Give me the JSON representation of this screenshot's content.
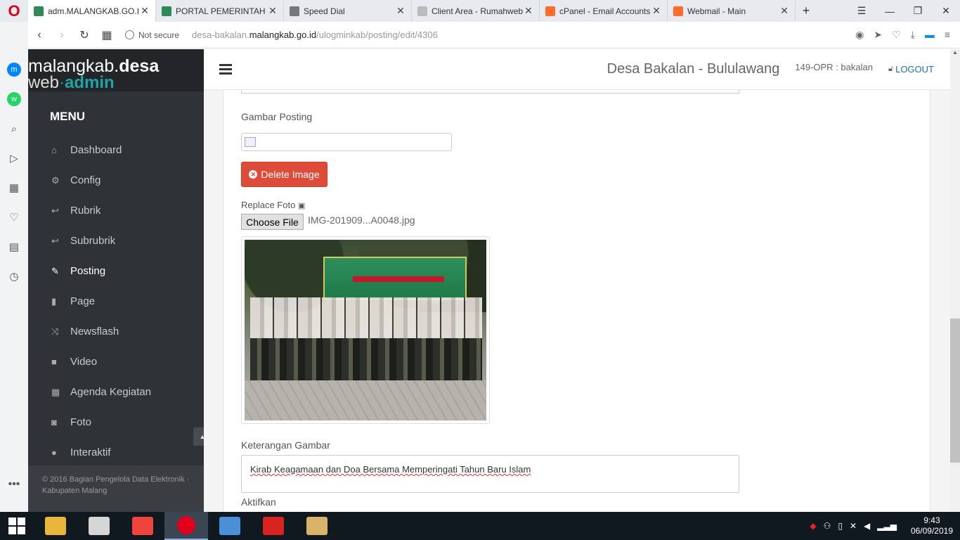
{
  "browser": {
    "tabs": [
      {
        "title": "adm.MALANGKAB.GO.ID",
        "active": true
      },
      {
        "title": "PORTAL PEMERINTAH K",
        "active": false
      },
      {
        "title": "Speed Dial",
        "active": false
      },
      {
        "title": "Client Area - Rumahweb",
        "active": false
      },
      {
        "title": "cPanel - Email Accounts",
        "active": false
      },
      {
        "title": "Webmail - Main",
        "active": false
      }
    ],
    "security_label": "Not secure",
    "url_prefix": "desa-bakalan.",
    "url_host": "malangkab.go.id",
    "url_path": "/ulogminkab/posting/edit/4306"
  },
  "brand": {
    "line1_plain": "malangkab.",
    "line1_bold": "desa",
    "line2_plain": "web",
    "line2_dot": "·",
    "line2_bold": "admin"
  },
  "sidebar": {
    "menu_title": "MENU",
    "items": [
      {
        "label": "Dashboard",
        "icon": "home-icon",
        "glyph": "⌂"
      },
      {
        "label": "Config",
        "icon": "gear-icon",
        "glyph": "⚙"
      },
      {
        "label": "Rubrik",
        "icon": "reply-icon",
        "glyph": "↩"
      },
      {
        "label": "Subrubrik",
        "icon": "reply-all-icon",
        "glyph": "↩"
      },
      {
        "label": "Posting",
        "icon": "edit-icon",
        "glyph": "✎"
      },
      {
        "label": "Page",
        "icon": "book-icon",
        "glyph": "▮"
      },
      {
        "label": "Newsflash",
        "icon": "random-icon",
        "glyph": "⤨"
      },
      {
        "label": "Video",
        "icon": "video-camera-icon",
        "glyph": "■"
      },
      {
        "label": "Agenda Kegiatan",
        "icon": "calendar-icon",
        "glyph": "▦"
      },
      {
        "label": "Foto",
        "icon": "camera-icon",
        "glyph": "◙"
      },
      {
        "label": "Interaktif",
        "icon": "comments-icon",
        "glyph": "●"
      }
    ],
    "footer_line1": "© 2016 Bagian Pengelola Data Elektronik ·",
    "footer_line2": "Kabupaten Malang"
  },
  "header": {
    "desa_title": "Desa Bakalan - Bululawang",
    "operator": "149-OPR : bakalan",
    "logout_label": "LOGOUT"
  },
  "form": {
    "gambar_label": "Gambar Posting",
    "delete_label": "Delete Image",
    "replace_label": "Replace Foto",
    "choose_file_label": "Choose File",
    "file_name": "IMG-201909...A0048.jpg",
    "keterangan_label": "Keterangan Gambar",
    "keterangan_value": "Kirab Keagamaan dan Doa Bersama Memperingati Tahun Baru Islam",
    "aktifkan_label": "Aktifkan"
  },
  "taskbar": {
    "time": "9:43",
    "date": "06/09/2019",
    "apps": [
      {
        "name": "file-explorer-icon",
        "color": "#e7b63a"
      },
      {
        "name": "notepad-icon",
        "color": "#d6d6d6"
      },
      {
        "name": "anydesk-icon",
        "color": "#ef443b"
      },
      {
        "name": "opera-icon",
        "color": "#e0001b"
      },
      {
        "name": "control-panel-icon",
        "color": "#4a90d9"
      },
      {
        "name": "acrobat-icon",
        "color": "#d8231f"
      },
      {
        "name": "paint-icon",
        "color": "#d9b36a"
      }
    ]
  },
  "colors": {
    "accent": "#1aa5a5",
    "danger": "#dd4b39",
    "sidebar_bg": "#2f3237",
    "link": "#1f6fb0"
  }
}
